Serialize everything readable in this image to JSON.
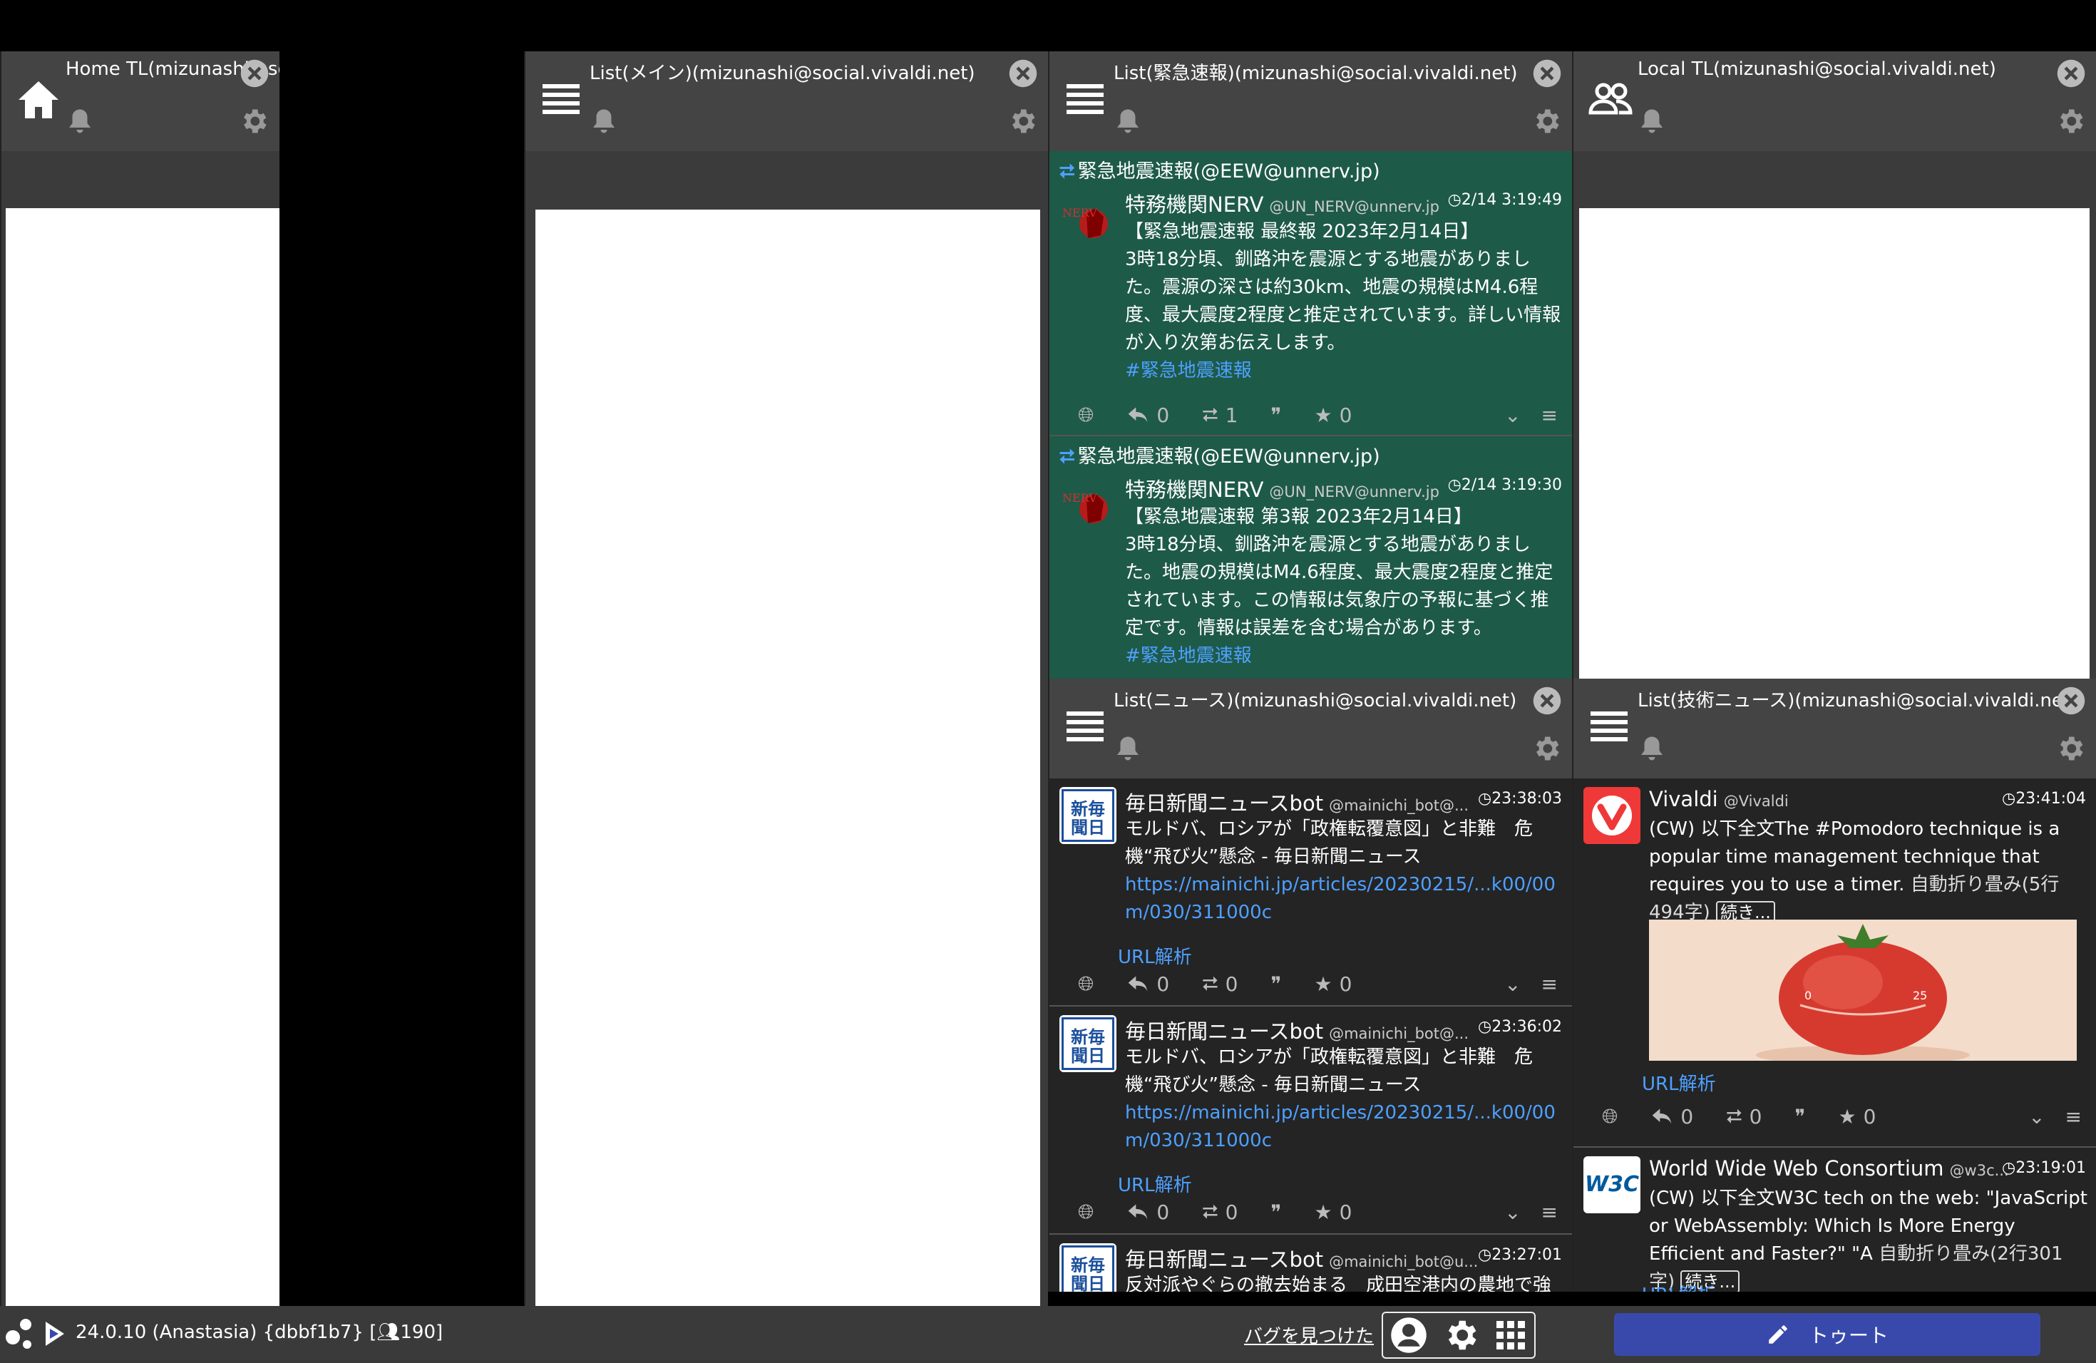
{
  "columns": [
    {
      "title": "Home TL(mizunashi@social.vivaldi.net)",
      "icon": "home-icon"
    },
    {
      "title": "List(メイン)(mizunashi@social.vivaldi.net)",
      "icon": "list-icon"
    },
    {
      "title": "List(緊急速報)(mizunashi@social.vivaldi.net)",
      "icon": "list-icon"
    },
    {
      "title": "Local TL(mizunashi@social.vivaldi.net)",
      "icon": "users-icon"
    },
    {
      "title": "List(ニュース)(mizunashi@social.vivaldi.net)",
      "icon": "list-icon"
    },
    {
      "title": "List(技術ニュース)(mizunashi@social.vivaldi.net)",
      "icon": "list-icon"
    }
  ],
  "emergency": {
    "toots": [
      {
        "boosted_by": "緊急地震速報(@EEW@unnerv.jp)",
        "name": "特務機関NERV",
        "handle": "@UN_NERV@unnerv.jp",
        "time": "2/14 3:19:49",
        "body": "【緊急地震速報 最終報 2023年2月14日】\n3時18分頃、釧路沖を震源とする地震がありました。震源の深さは約30km、地震の規模はM4.6程度、最大震度2程度と推定されています。詳しい情報が入り次第お伝えします。",
        "tag": "#緊急地震速報",
        "replies": "0",
        "boosts": "1",
        "favs": "0"
      },
      {
        "boosted_by": "緊急地震速報(@EEW@unnerv.jp)",
        "name": "特務機関NERV",
        "handle": "@UN_NERV@unnerv.jp",
        "time": "2/14 3:19:30",
        "body": "【緊急地震速報 第3報 2023年2月14日】\n3時18分頃、釧路沖を震源とする地震がありました。地震の規模はM4.6程度、最大震度2程度と推定されています。この情報は気象庁の予報に基づく推定です。情報は誤差を含む場合があります。",
        "tag": "#緊急地震速報"
      }
    ]
  },
  "news": {
    "toots": [
      {
        "name": "毎日新聞ニュースbot",
        "handle": "@mainichi_bot@...",
        "time": "23:38:03",
        "body": "モルドバ、ロシアが「政権転覆意図」と非難　危機“飛び火”懸念 - 毎日新聞ニュース",
        "link": "https://mainichi.jp/articles/20230215/...k00/00m/030/311000c",
        "url_parse": "URL解析",
        "replies": "0",
        "boosts": "0",
        "favs": "0"
      },
      {
        "name": "毎日新聞ニュースbot",
        "handle": "@mainichi_bot@...",
        "time": "23:36:02",
        "body": "モルドバ、ロシアが「政権転覆意図」と非難　危機“飛び火”懸念 - 毎日新聞ニュース",
        "link": "https://mainichi.jp/articles/20230215/...k00/00m/030/311000c",
        "url_parse": "URL解析",
        "replies": "0",
        "boosts": "0",
        "favs": "0"
      },
      {
        "name": "毎日新聞ニュースbot",
        "handle": "@mainichi_bot@u...",
        "time": "23:27:01",
        "body": "反対派やぐらの撤去始まる　成田空港内の農地で強"
      }
    ]
  },
  "tech": {
    "toots": [
      {
        "name": "Vivaldi",
        "handle": "@Vivaldi",
        "time": "23:41:04",
        "body": "(CW) 以下全文The #Pomodoro technique is a popular time management technique that requires you to use a timer.",
        "fold": "自動折り畳み(5行494字)",
        "more": "続き...",
        "url_parse": "URL解析",
        "replies": "0",
        "boosts": "0",
        "favs": "0",
        "timer_marks": [
          "0",
          "25"
        ]
      },
      {
        "name": "World Wide Web Consortium",
        "handle": "@w3c...",
        "time": "23:19:01",
        "body": "(CW) 以下全文W3C tech on the web: \"JavaScript or WebAssembly: Which Is More Energy Efficient and Faster?\" \"A",
        "fold": "自動折り畳み(2行301字)",
        "more": "続き...",
        "url_parse": "URL解析"
      }
    ]
  },
  "avatars": {
    "mainichi_text": "新毎\n聞日",
    "w3c_text": "W3C"
  },
  "status": {
    "version": "24.0.10 (Anastasia) {dbbf1b7} [",
    "users": "190]",
    "bug": "バグを見つけた",
    "toot_button": "トゥート"
  },
  "colors": {
    "accent": "#3949ab",
    "link": "#4ea0ff",
    "emergency_bg": "#1e5a48"
  }
}
